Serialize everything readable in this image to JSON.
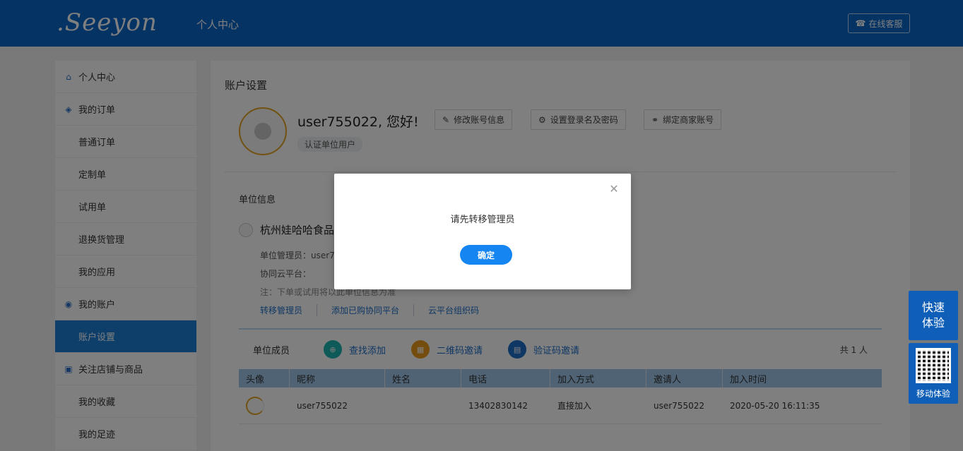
{
  "header": {
    "logo_text": ".Seeyon",
    "title": "个人中心",
    "help_label": "在线客服"
  },
  "sidebar": {
    "items": [
      {
        "label": "个人中心",
        "icon": "home-icon"
      },
      {
        "label": "我的订单",
        "icon": "layers-icon"
      },
      {
        "label": "普通订单"
      },
      {
        "label": "定制单"
      },
      {
        "label": "试用单"
      },
      {
        "label": "退换货管理"
      },
      {
        "label": "我的应用"
      },
      {
        "label": "我的账户",
        "icon": "user-circle-icon"
      },
      {
        "label": "账户设置",
        "active": true
      },
      {
        "label": "关注店铺与商品",
        "icon": "shop-icon"
      },
      {
        "label": "我的收藏"
      },
      {
        "label": "我的足迹"
      }
    ]
  },
  "main": {
    "title": "账户设置",
    "greeting": "user755022, 您好!",
    "cert_tag": "认证单位用户",
    "buttons": {
      "edit_account": "修改账号信息",
      "set_login": "设置登录名及密码",
      "bind_merchant": "绑定商家账号"
    },
    "unit_section_title": "单位信息",
    "company_name": "杭州娃哈哈食品",
    "unit_admin": "单位管理员：user7",
    "cloud_platform": "协同云平台：",
    "note": "注：下单或试用将以此单位信息为准",
    "links": [
      "转移管理员",
      "添加已购协同平台",
      "云平台组织码"
    ]
  },
  "members": {
    "title": "单位成员",
    "actions": [
      "查找添加",
      "二维码邀请",
      "验证码邀请"
    ],
    "count": "共 1 人",
    "columns": [
      "头像",
      "昵称",
      "姓名",
      "电话",
      "加入方式",
      "邀请人",
      "加入时间"
    ],
    "rows": [
      {
        "nickname": "user755022",
        "name": "",
        "phone": "13402830142",
        "join_method": "直接加入",
        "inviter": "user755022",
        "join_time": "2020-05-20 16:11:35"
      }
    ]
  },
  "float": {
    "quick_line1": "快速",
    "quick_line2": "体验",
    "mobile_label": "移动体验"
  },
  "modal": {
    "message": "请先转移管理员",
    "ok_label": "确定"
  },
  "colors": {
    "header_blue": "#0a67c9",
    "active_blue": "#1d7fd6",
    "button_blue": "#1585f2",
    "avatar_ring": "#e3a523"
  }
}
